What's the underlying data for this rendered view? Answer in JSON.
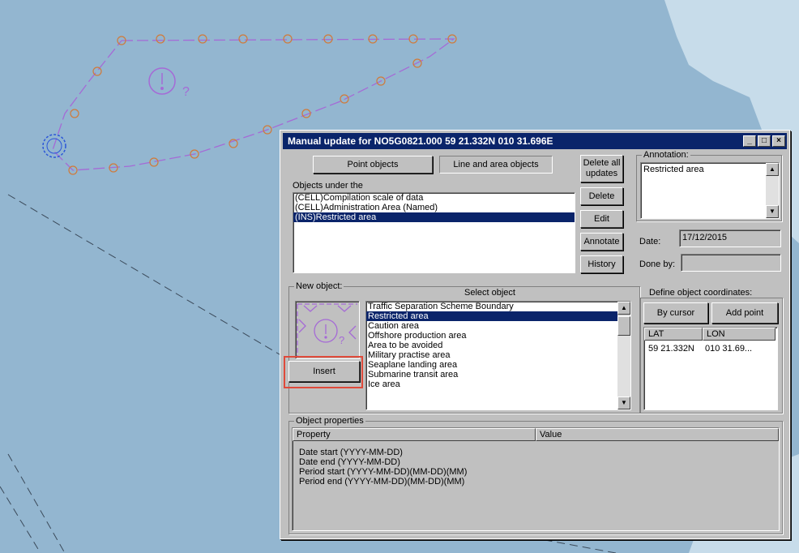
{
  "window": {
    "title": "Manual update for NO5G0821.000  59 21.332N  010 31.696E",
    "controls": {
      "minimize": "_",
      "maximize": "□",
      "close": "×"
    }
  },
  "map": {
    "symbol_question": "?"
  },
  "tabs": {
    "point_objects": "Point objects",
    "line_area_objects": "Line and area objects"
  },
  "objects_under": {
    "label": "Objects under the",
    "items": [
      "(CELL)Compilation scale of data",
      "(CELL)Administration Area (Named)",
      "(INS)Restricted area"
    ],
    "selected_index": 2
  },
  "actions": {
    "delete_all": "Delete all updates",
    "delete": "Delete",
    "edit": "Edit",
    "annotate": "Annotate",
    "history": "History"
  },
  "annotation": {
    "label": "Annotation:",
    "value": "Restricted area"
  },
  "date": {
    "label": "Date:",
    "value": "17/12/2015"
  },
  "done_by": {
    "label": "Done by:",
    "value": ""
  },
  "new_object": {
    "label": "New object:",
    "select_label": "Select object",
    "insert_button": "Insert",
    "symbol_question": "?",
    "objects": [
      "Traffic Separation Scheme  Boundary",
      "Restricted area",
      "Caution area",
      "Offshore production area",
      "Area to be avoided",
      "Military practise area",
      "Seaplane landing area",
      "Submarine transit area",
      "Ice area"
    ],
    "selected_index": 1
  },
  "coordinates": {
    "label": "Define object coordinates:",
    "by_cursor": "By cursor",
    "add_point": "Add point",
    "col_lat": "LAT",
    "col_lon": "LON",
    "rows": [
      {
        "lat": "59 21.332N",
        "lon": "010 31.69..."
      }
    ]
  },
  "object_properties": {
    "label": "Object properties",
    "col_property": "Property",
    "col_value": "Value",
    "rows": [
      "Date start (YYYY-MM-DD)",
      "Date end (YYYY-MM-DD)",
      "Period start (YYYY-MM-DD)(MM-DD)(MM)",
      "Period end (YYYY-MM-DD)(MM-DD)(MM)"
    ]
  },
  "colors": {
    "map_water": "#93b6d0",
    "land": "#c7dcea",
    "symbol": "#a56ad6",
    "highlight": "#e04a3a",
    "selection": "#0a246a"
  }
}
